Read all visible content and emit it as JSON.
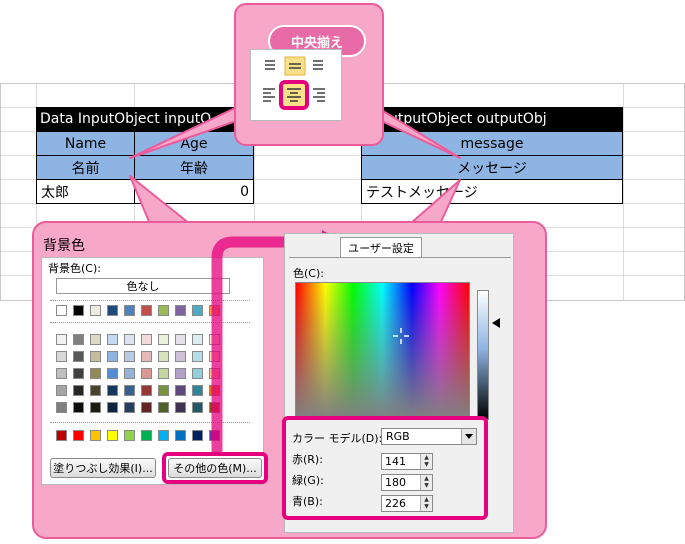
{
  "callout_top": {
    "label": "中央揃え"
  },
  "input_table": {
    "title": "Data InputObject inputO",
    "headers": [
      "Name",
      "Age"
    ],
    "labels": [
      "名前",
      "年齢"
    ],
    "row": [
      "太郎",
      "0"
    ]
  },
  "output_table": {
    "title": "a OutputObject outputObj",
    "header": "message",
    "label": "メッセージ",
    "row": "テストメッセージ"
  },
  "bg_panel": {
    "title": "背景色",
    "bg_color_label": "背景色(C):",
    "no_color": "色なし",
    "fill_effects_button": "塗りつぶし効果(I)...",
    "more_colors_button": "その他の色(M)...",
    "swatch_rows": [
      [
        "#ffffff",
        "#000000",
        "#eeece1",
        "#1f497d",
        "#4f81bd",
        "#c0504d",
        "#9bbb59",
        "#8064a2",
        "#4bacc6",
        "#f79646"
      ],
      [
        "#f2f2f2",
        "#7f7f7f",
        "#ddd9c3",
        "#c6d9f0",
        "#dbe5f1",
        "#f2dcdb",
        "#ebf1dd",
        "#e5e0ec",
        "#dbeef3",
        "#fdeada"
      ],
      [
        "#d8d8d8",
        "#595959",
        "#c4bd97",
        "#8db3e2",
        "#b8cce4",
        "#e5b9b7",
        "#d7e3bc",
        "#ccc1d9",
        "#b7dde8",
        "#fbd5b5"
      ],
      [
        "#bfbfbf",
        "#3f3f3f",
        "#938953",
        "#548dd4",
        "#95b3d7",
        "#d99694",
        "#c3d69b",
        "#b2a2c7",
        "#92cddc",
        "#fac08f"
      ],
      [
        "#a5a5a5",
        "#262626",
        "#494429",
        "#17365d",
        "#366092",
        "#953734",
        "#76923c",
        "#5f497a",
        "#31859b",
        "#e36c09"
      ],
      [
        "#7f7f7f",
        "#0c0c0c",
        "#1d1b10",
        "#0f243e",
        "#244061",
        "#632423",
        "#4f6128",
        "#3f3151",
        "#205867",
        "#974806"
      ]
    ],
    "standard_colors": [
      "#c00000",
      "#ff0000",
      "#ffc000",
      "#ffff00",
      "#92d050",
      "#00b050",
      "#00b0f0",
      "#0070c0",
      "#002060",
      "#7030a0"
    ]
  },
  "color_dialog": {
    "tab_label": "ユーザー設定",
    "colors_label": "色(C):",
    "model_label": "カラー モデル(D):",
    "model_value": "RGB",
    "red_label": "赤(R):",
    "green_label": "緑(G):",
    "blue_label": "青(B):",
    "red": "141",
    "green": "180",
    "blue": "226"
  },
  "colors": {
    "accent_pink": "#e5007e",
    "panel_pink": "#f7a7c8",
    "header_blue": "#8db4e2"
  }
}
